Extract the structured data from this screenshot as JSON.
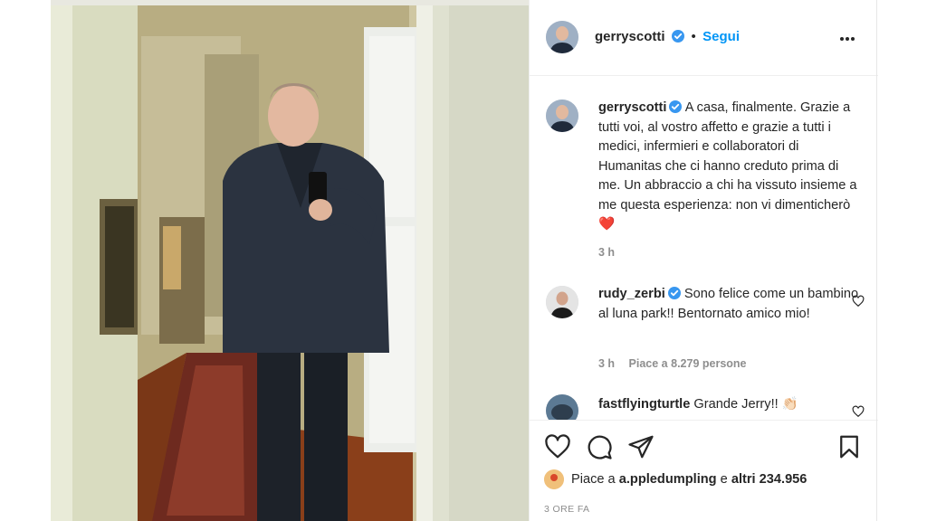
{
  "post": {
    "author": "gerryscotti",
    "follow_label": "Segui",
    "dot": "•",
    "caption": "A casa, finalmente. Grazie a tutti voi, al vostro affetto e grazie a tutti i medici, infermieri e collaboratori di Humanitas che ci hanno creduto prima di me. Un abbraccio a chi ha vissuto insieme a me questa esperienza: non vi dimenticherò ❤️",
    "caption_time": "3 h"
  },
  "comments": [
    {
      "user": "rudy_zerbi",
      "verified": true,
      "text": "Sono felice come un bambino al luna park!! Bentornato amico mio!",
      "time": "3 h",
      "likes": "Piace a 8.279 persone"
    },
    {
      "user": "fastflyingturtle",
      "verified": false,
      "text": "Grande Jerry!! 👏🏻"
    }
  ],
  "likes": {
    "prefix": "Piace a",
    "user": "a.ppledumpling",
    "conj": "e",
    "others": "altri 234.956"
  },
  "time_ago": "3 ORE FA",
  "icons": {
    "verified": "verified-badge-icon",
    "more": "more-options-icon",
    "heart": "heart-icon",
    "comment": "comment-icon",
    "share": "share-icon",
    "save": "bookmark-icon"
  },
  "colors": {
    "link": "#0095f6",
    "verified": "#3897f0",
    "text": "#262626",
    "muted": "#8e8e8e"
  }
}
